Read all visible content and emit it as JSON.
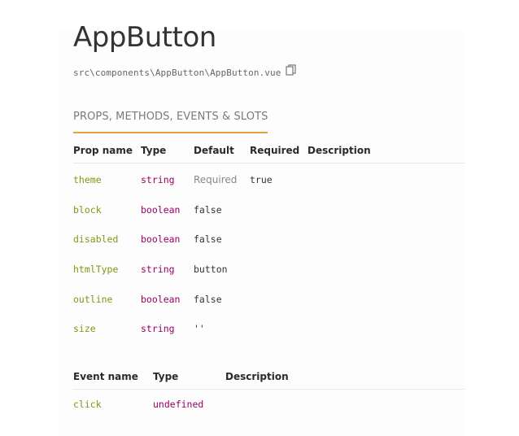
{
  "component": {
    "title": "AppButton",
    "path": "src\\components\\AppButton\\AppButton.vue",
    "copy_icon": "copy-icon"
  },
  "tabs": [
    {
      "label": "PROPS, METHODS, EVENTS & SLOTS",
      "active": true
    }
  ],
  "props_table": {
    "headers": {
      "name": "Prop name",
      "type": "Type",
      "default": "Default",
      "required": "Required",
      "description": "Description"
    },
    "rows": [
      {
        "name": "theme",
        "type": "string",
        "default": "Required",
        "required": "true",
        "description": ""
      },
      {
        "name": "block",
        "type": "boolean",
        "default": "false",
        "required": "",
        "description": ""
      },
      {
        "name": "disabled",
        "type": "boolean",
        "default": "false",
        "required": "",
        "description": ""
      },
      {
        "name": "htmlType",
        "type": "string",
        "default": "button",
        "required": "",
        "description": ""
      },
      {
        "name": "outline",
        "type": "boolean",
        "default": "false",
        "required": "",
        "description": ""
      },
      {
        "name": "size",
        "type": "string",
        "default": "''",
        "required": "",
        "description": ""
      }
    ]
  },
  "events_table": {
    "headers": {
      "name": "Event name",
      "type": "Type",
      "description": "Description"
    },
    "rows": [
      {
        "name": "click",
        "type": "undefined",
        "description": ""
      }
    ]
  },
  "colors": {
    "accent": "#e6a23c",
    "prop_name": "#7c9a12",
    "type": "#990066"
  }
}
